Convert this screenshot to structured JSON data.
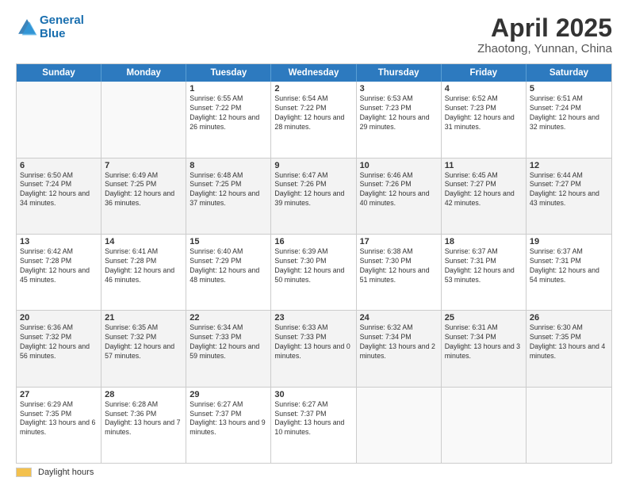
{
  "header": {
    "title": "April 2025",
    "subtitle": "Zhaotong, Yunnan, China"
  },
  "logo": {
    "line1": "General",
    "line2": "Blue"
  },
  "weekdays": [
    "Sunday",
    "Monday",
    "Tuesday",
    "Wednesday",
    "Thursday",
    "Friday",
    "Saturday"
  ],
  "footer": {
    "swatch_label": "Daylight hours"
  },
  "rows": [
    [
      {
        "day": "",
        "info": ""
      },
      {
        "day": "",
        "info": ""
      },
      {
        "day": "1",
        "info": "Sunrise: 6:55 AM\nSunset: 7:22 PM\nDaylight: 12 hours and 26 minutes."
      },
      {
        "day": "2",
        "info": "Sunrise: 6:54 AM\nSunset: 7:22 PM\nDaylight: 12 hours and 28 minutes."
      },
      {
        "day": "3",
        "info": "Sunrise: 6:53 AM\nSunset: 7:23 PM\nDaylight: 12 hours and 29 minutes."
      },
      {
        "day": "4",
        "info": "Sunrise: 6:52 AM\nSunset: 7:23 PM\nDaylight: 12 hours and 31 minutes."
      },
      {
        "day": "5",
        "info": "Sunrise: 6:51 AM\nSunset: 7:24 PM\nDaylight: 12 hours and 32 minutes."
      }
    ],
    [
      {
        "day": "6",
        "info": "Sunrise: 6:50 AM\nSunset: 7:24 PM\nDaylight: 12 hours and 34 minutes."
      },
      {
        "day": "7",
        "info": "Sunrise: 6:49 AM\nSunset: 7:25 PM\nDaylight: 12 hours and 36 minutes."
      },
      {
        "day": "8",
        "info": "Sunrise: 6:48 AM\nSunset: 7:25 PM\nDaylight: 12 hours and 37 minutes."
      },
      {
        "day": "9",
        "info": "Sunrise: 6:47 AM\nSunset: 7:26 PM\nDaylight: 12 hours and 39 minutes."
      },
      {
        "day": "10",
        "info": "Sunrise: 6:46 AM\nSunset: 7:26 PM\nDaylight: 12 hours and 40 minutes."
      },
      {
        "day": "11",
        "info": "Sunrise: 6:45 AM\nSunset: 7:27 PM\nDaylight: 12 hours and 42 minutes."
      },
      {
        "day": "12",
        "info": "Sunrise: 6:44 AM\nSunset: 7:27 PM\nDaylight: 12 hours and 43 minutes."
      }
    ],
    [
      {
        "day": "13",
        "info": "Sunrise: 6:42 AM\nSunset: 7:28 PM\nDaylight: 12 hours and 45 minutes."
      },
      {
        "day": "14",
        "info": "Sunrise: 6:41 AM\nSunset: 7:28 PM\nDaylight: 12 hours and 46 minutes."
      },
      {
        "day": "15",
        "info": "Sunrise: 6:40 AM\nSunset: 7:29 PM\nDaylight: 12 hours and 48 minutes."
      },
      {
        "day": "16",
        "info": "Sunrise: 6:39 AM\nSunset: 7:30 PM\nDaylight: 12 hours and 50 minutes."
      },
      {
        "day": "17",
        "info": "Sunrise: 6:38 AM\nSunset: 7:30 PM\nDaylight: 12 hours and 51 minutes."
      },
      {
        "day": "18",
        "info": "Sunrise: 6:37 AM\nSunset: 7:31 PM\nDaylight: 12 hours and 53 minutes."
      },
      {
        "day": "19",
        "info": "Sunrise: 6:37 AM\nSunset: 7:31 PM\nDaylight: 12 hours and 54 minutes."
      }
    ],
    [
      {
        "day": "20",
        "info": "Sunrise: 6:36 AM\nSunset: 7:32 PM\nDaylight: 12 hours and 56 minutes."
      },
      {
        "day": "21",
        "info": "Sunrise: 6:35 AM\nSunset: 7:32 PM\nDaylight: 12 hours and 57 minutes."
      },
      {
        "day": "22",
        "info": "Sunrise: 6:34 AM\nSunset: 7:33 PM\nDaylight: 12 hours and 59 minutes."
      },
      {
        "day": "23",
        "info": "Sunrise: 6:33 AM\nSunset: 7:33 PM\nDaylight: 13 hours and 0 minutes."
      },
      {
        "day": "24",
        "info": "Sunrise: 6:32 AM\nSunset: 7:34 PM\nDaylight: 13 hours and 2 minutes."
      },
      {
        "day": "25",
        "info": "Sunrise: 6:31 AM\nSunset: 7:34 PM\nDaylight: 13 hours and 3 minutes."
      },
      {
        "day": "26",
        "info": "Sunrise: 6:30 AM\nSunset: 7:35 PM\nDaylight: 13 hours and 4 minutes."
      }
    ],
    [
      {
        "day": "27",
        "info": "Sunrise: 6:29 AM\nSunset: 7:35 PM\nDaylight: 13 hours and 6 minutes."
      },
      {
        "day": "28",
        "info": "Sunrise: 6:28 AM\nSunset: 7:36 PM\nDaylight: 13 hours and 7 minutes."
      },
      {
        "day": "29",
        "info": "Sunrise: 6:27 AM\nSunset: 7:37 PM\nDaylight: 13 hours and 9 minutes."
      },
      {
        "day": "30",
        "info": "Sunrise: 6:27 AM\nSunset: 7:37 PM\nDaylight: 13 hours and 10 minutes."
      },
      {
        "day": "",
        "info": ""
      },
      {
        "day": "",
        "info": ""
      },
      {
        "day": "",
        "info": ""
      }
    ]
  ]
}
